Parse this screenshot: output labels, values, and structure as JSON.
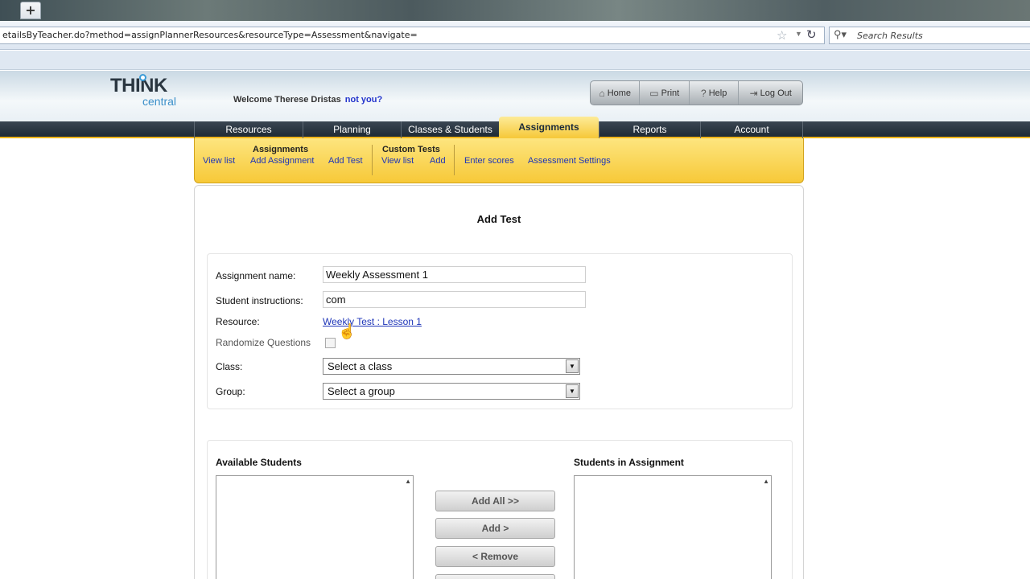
{
  "browser": {
    "newtab_label": "+",
    "url": "etailsByTeacher.do?method=assignPlannerResources&resourceType=Assessment&navigate=",
    "search_placeholder": "Search Results"
  },
  "header": {
    "logo_think": "THINK",
    "logo_central": "central",
    "welcome_text": "Welcome Therese Dristas",
    "not_you": "not you?",
    "tools": [
      {
        "label": "Home",
        "icon": "home-icon"
      },
      {
        "label": "Print",
        "icon": "printer-icon"
      },
      {
        "label": "Help",
        "icon": "help-icon"
      },
      {
        "label": "Log Out",
        "icon": "logout-icon"
      }
    ]
  },
  "nav": {
    "items": [
      "Resources",
      "Planning",
      "Classes & Students",
      "Assignments",
      "Reports",
      "Account"
    ],
    "active": "Assignments"
  },
  "subnav": {
    "view_list": "View list",
    "assignments_heading": "Assignments",
    "add_assignment": "Add Assignment",
    "add_test": "Add Test",
    "custom_tests_heading": "Custom Tests",
    "custom_view_list": "View list",
    "custom_add": "Add",
    "enter_scores": "Enter scores",
    "assessment_settings": "Assessment Settings"
  },
  "form": {
    "title": "Add Test",
    "assignment_name_label": "Assignment name:",
    "assignment_name_value": "Weekly Assessment 1",
    "instructions_label": "Student instructions:",
    "instructions_value": "com",
    "resource_label": "Resource:",
    "resource_value": "Weekly Test : Lesson 1",
    "randomize_label": "Randomize Questions",
    "randomize_checked": false,
    "class_label": "Class:",
    "class_value": "Select a class",
    "group_label": "Group:",
    "group_value": "Select a group"
  },
  "students": {
    "available_label": "Available Students",
    "assigned_label": "Students in Assignment",
    "add_all": "Add All >>",
    "add": "Add >",
    "remove": "< Remove"
  },
  "colors": {
    "nav_active": "#f6c838",
    "subnav_bg": "#fde57f",
    "link": "#1e35b8",
    "nav_bg": "#2a3540"
  }
}
